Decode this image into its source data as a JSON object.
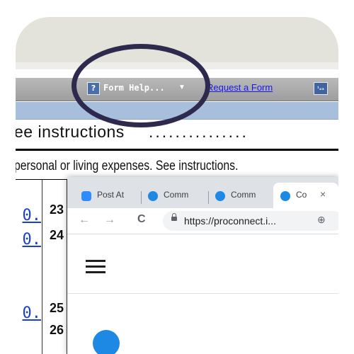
{
  "toolbar": {
    "form_help_icon": "?",
    "form_help_label": "Form Help...",
    "form_help_caret": "▼",
    "request_form_label": "Request a Form",
    "calculator_icon": "¹₂₃"
  },
  "form": {
    "instructions_line": "ee instructions",
    "dot_leader": "...............",
    "personal_line": "personal or living expenses. See instructions.",
    "rows": [
      {
        "amount": "0.",
        "line": "23"
      },
      {
        "amount": "0.",
        "line": "24"
      },
      {
        "amount": "0.",
        "line": "25"
      },
      {
        "amount": "",
        "line": "26"
      }
    ]
  },
  "browser": {
    "tabs": [
      {
        "title": "Post At"
      },
      {
        "title": "Comm"
      },
      {
        "title": "Comm"
      },
      {
        "title": "Co",
        "active": true
      }
    ],
    "tab_close": "×",
    "back": "←",
    "forward": "→",
    "reload": "C",
    "url": "https://proconnect.i...",
    "zoom_icon": "⊕",
    "menu_icon": "hamburger"
  }
}
